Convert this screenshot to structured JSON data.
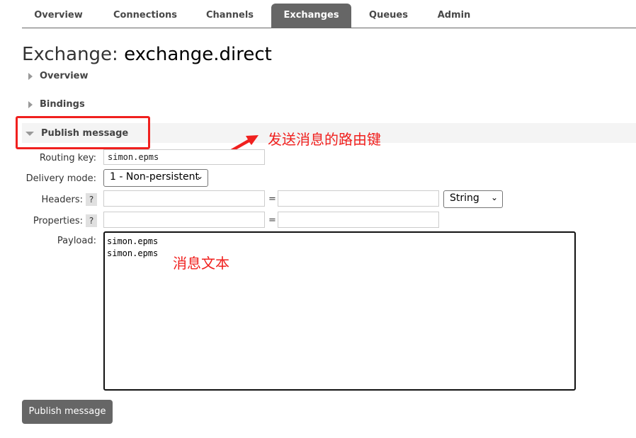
{
  "nav": {
    "tabs": [
      "Overview",
      "Connections",
      "Channels",
      "Exchanges",
      "Queues",
      "Admin"
    ],
    "active": "Exchanges"
  },
  "title": {
    "prefix": "Exchange:",
    "name": "exchange.direct"
  },
  "sections": {
    "overview": "Overview",
    "bindings": "Bindings",
    "publish": "Publish message"
  },
  "form": {
    "routing_key_label": "Routing key:",
    "routing_key": "simon.epms",
    "delivery_mode_label": "Delivery mode:",
    "delivery_mode": "1 - Non-persistent",
    "headers_label": "Headers:",
    "help": "?",
    "equals": "=",
    "header_type": "String",
    "properties_label": "Properties:",
    "payload_label": "Payload:",
    "payload": "simon.epms\nsimon.epms"
  },
  "publish_button": "Publish message",
  "annotations": {
    "routing_key_note": "发送消息的路由键",
    "payload_note": "消息文本",
    "color": "#f0201e"
  }
}
